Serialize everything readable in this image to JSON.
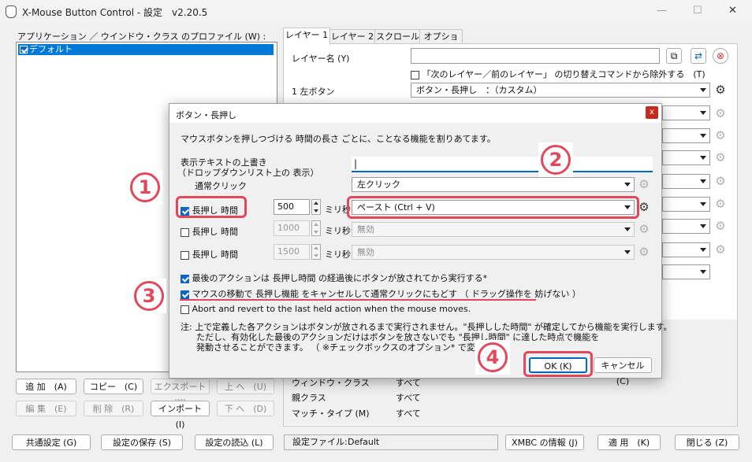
{
  "window": {
    "title": "X-Mouse Button Control - 設定　v2.20.5",
    "minimize": "—",
    "maximize": "☐",
    "close": "✕"
  },
  "profiles": {
    "label": "アプリケーション ／ ウインドウ・クラス のプロファイル (W) :",
    "items": [
      "デフォルト"
    ]
  },
  "profile_buttons": {
    "add": "追 加　(A)",
    "copy": "コピー　(C)",
    "export": "エクスポート (X)",
    "up": "上 へ　(U)",
    "edit": "編 集　(E)",
    "delete": "削 除　(R)",
    "import": "インポート　(I)",
    "down": "下 へ　(D)"
  },
  "tabs": [
    "レイヤー 1",
    "レイヤー 2",
    "スクロール",
    "オプション"
  ],
  "layer_panel": {
    "layer_name_label": "レイヤー名 (Y)",
    "exclude_label": "「次のレイヤー／前のレイヤー」 の切り替えコマンドから除外する　(T)",
    "left_button_label": "1  左ボタン",
    "left_button_value": "ボタン・長押し　：（カスタム）"
  },
  "profile_info": {
    "row1_label": "ウィンドウ・クラス",
    "row1_value": "すべて",
    "row2_label": "親クラス",
    "row2_value": "すべて",
    "row3_label": "マッチ・タイプ (M)",
    "row3_value": "すべて"
  },
  "bottom": {
    "common_settings": "共通設定 (G)",
    "save_settings": "設定の保存 (S)",
    "load_settings": "設定の読込 (L)",
    "settings_file_label": "設定ファイル:",
    "settings_file_value": "Default",
    "info": "XMBC の情報 (J)",
    "apply": "適 用　(K)",
    "close": "閉じる (Z)"
  },
  "dialog": {
    "title": "ボタン・長押し",
    "close": "x",
    "description": "マウスボタンを押しつづける 時間の長さ ごとに、ことなる機能を割りあてます。",
    "override_label_1": "表示テキストの上書き",
    "override_label_2": "（ドロップダウンリスト上の 表示）",
    "override_value": "|",
    "normal_click_label": "通常クリック",
    "normal_click_value": "左クリック",
    "rows": [
      {
        "label": "長押し 時間",
        "ms": "500",
        "unit": "ミリ秒",
        "action": "ペースト  (Ctrl + V)",
        "checked": true
      },
      {
        "label": "長押し 時間",
        "ms": "1000",
        "unit": "ミリ秒",
        "action": "無効",
        "checked": false
      },
      {
        "label": "長押し 時間",
        "ms": "1500",
        "unit": "ミリ秒",
        "action": "無効",
        "checked": false
      }
    ],
    "option1": "最後のアクションは 長押し時間 の経過後にボタンが放されてから実行する*",
    "option2": "マウスの移動で 長押し機能 をキャンセルして通常クリックにもどす （ ドラッグ操作を 妨げない ）",
    "option3": "Abort and revert to the last held action when the mouse moves.",
    "note1": "注:  上で定義した各アクションはボタンが放されるまで実行されません。\"長押しした時間\" が確定してから機能を実行します。",
    "note2": "ただし、有効化した最後のアクションだけはボタンを放さないでも \"長押し時間\" に達した時点で機能を",
    "note3": "発動させることができます。 （ ※チェックボックスのオプション* で変更可 ）",
    "ok": "OK  (K)",
    "cancel": "キャンセル (C)"
  },
  "annotations": {
    "n1": "1",
    "n2": "2",
    "n3": "3",
    "n4": "4",
    "color": "#e0495b"
  }
}
